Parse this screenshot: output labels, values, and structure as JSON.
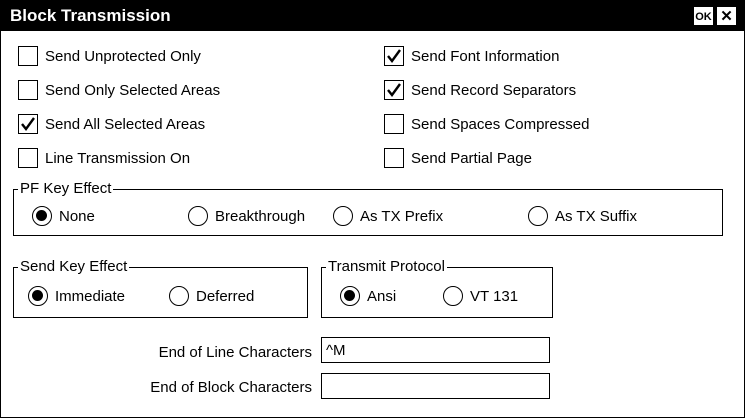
{
  "window": {
    "title": "Block Transmission",
    "ok_label": "OK",
    "close_label": "✕"
  },
  "checkboxes": [
    {
      "label": "Send Unprotected Only",
      "checked": false
    },
    {
      "label": "Send Only Selected Areas",
      "checked": false
    },
    {
      "label": "Send All Selected Areas",
      "checked": true
    },
    {
      "label": "Line Transmission On",
      "checked": false
    },
    {
      "label": "Send Font Information",
      "checked": true
    },
    {
      "label": "Send Record Separators",
      "checked": true
    },
    {
      "label": "Send Spaces Compressed",
      "checked": false
    },
    {
      "label": "Send Partial Page",
      "checked": false
    }
  ],
  "pf_key": {
    "legend": "PF Key Effect",
    "options": [
      {
        "label": "None",
        "selected": true
      },
      {
        "label": "Breakthrough",
        "selected": false
      },
      {
        "label": "As TX Prefix",
        "selected": false
      },
      {
        "label": "As TX Suffix",
        "selected": false
      }
    ]
  },
  "send_key": {
    "legend": "Send Key Effect",
    "options": [
      {
        "label": "Immediate",
        "selected": true
      },
      {
        "label": "Deferred",
        "selected": false
      }
    ]
  },
  "protocol": {
    "legend": "Transmit Protocol",
    "options": [
      {
        "label": "Ansi",
        "selected": true
      },
      {
        "label": "VT 131",
        "selected": false
      }
    ]
  },
  "fields": {
    "eol_label": "End of Line Characters",
    "eol_value": "^M",
    "eob_label": "End of Block Characters",
    "eob_value": ""
  }
}
